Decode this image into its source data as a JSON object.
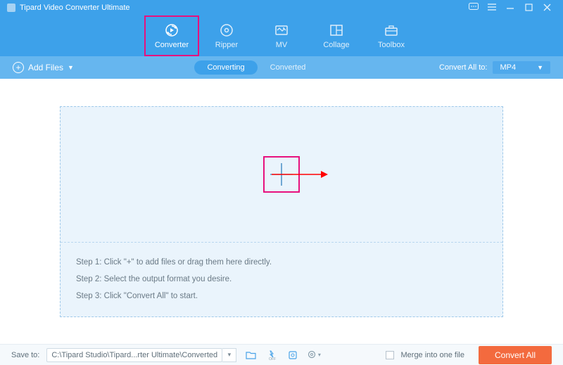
{
  "title": "Tipard Video Converter Ultimate",
  "tabs": [
    {
      "label": "Converter"
    },
    {
      "label": "Ripper"
    },
    {
      "label": "MV"
    },
    {
      "label": "Collage"
    },
    {
      "label": "Toolbox"
    }
  ],
  "subbar": {
    "add_files": "Add Files",
    "converting": "Converting",
    "converted": "Converted",
    "convert_all_to": "Convert All to:",
    "format": "MP4"
  },
  "drop": {
    "step1": "Step 1: Click \"+\" to add files or drag them here directly.",
    "step2": "Step 2: Select the output format you desire.",
    "step3": "Step 3: Click \"Convert All\" to start."
  },
  "footer": {
    "save_to": "Save to:",
    "path": "C:\\Tipard Studio\\Tipard...rter Ultimate\\Converted",
    "merge": "Merge into one file",
    "convert_all": "Convert All"
  }
}
